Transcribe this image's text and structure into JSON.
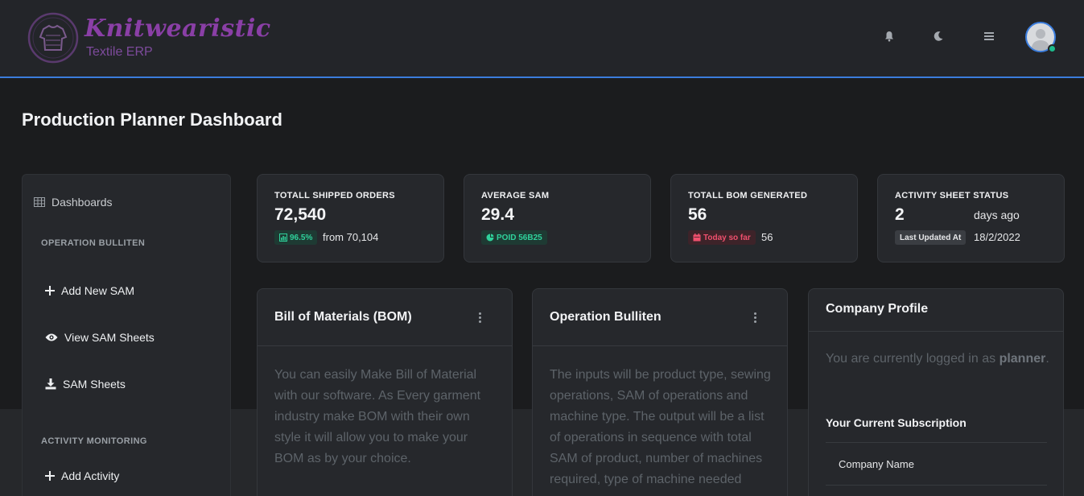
{
  "brand": {
    "name": "Knitwearistic",
    "subtitle": "Textile ERP"
  },
  "header": {
    "icons": [
      "bell-icon",
      "moon-icon",
      "menu-icon"
    ],
    "avatar_status_color": "#1cbb8c",
    "accent": "#3b7ddd"
  },
  "page": {
    "title": "Production Planner Dashboard"
  },
  "sidebar": {
    "dashboards": "Dashboards",
    "section1": "OPERATION BULLITEN",
    "items1": [
      "Add New SAM",
      "View SAM Sheets",
      "SAM Sheets"
    ],
    "section2": "ACTIVITY MONITORING",
    "items2": [
      "Add Activity"
    ]
  },
  "stats": [
    {
      "label": "TOTALL SHIPPED ORDERS",
      "value": "72,540",
      "badge": "96.5%",
      "sub": "from 70,104"
    },
    {
      "label": "AVERAGE SAM",
      "value": "29.4",
      "badge": "POID 56B25"
    },
    {
      "label": "TOTALL BOM GENERATED",
      "value": "56",
      "badge": "Today so far",
      "sub": "56"
    },
    {
      "label": "ACTIVITY SHEET STATUS",
      "value": "2",
      "value_suffix": "days ago",
      "badge": "Last Updated At",
      "sub": "18/2/2022"
    }
  ],
  "panels": {
    "bom": {
      "title": "Bill of Materials (BOM)",
      "body": "You can easily Make Bill of Material with our software. As Every garment industry make BOM with their own style it will allow you to make your BOM as by your choice."
    },
    "ob": {
      "title": "Operation Bulliten",
      "body": "The inputs will be product type, sewing operations, SAM of operations and machine type. The output will be a list of operations in sequence with total SAM of product, number of machines required, type of machine needed"
    },
    "company": {
      "title": "Company Profile",
      "logged_prefix": "You are currently logged in as",
      "user": "planner",
      "subscription_title": "Your Current Subscription",
      "company_name_label": "Company Name"
    }
  },
  "colors": {
    "green": "#2fd19b",
    "red": "#f0506e",
    "brand_purple": "#8a3fa6"
  }
}
